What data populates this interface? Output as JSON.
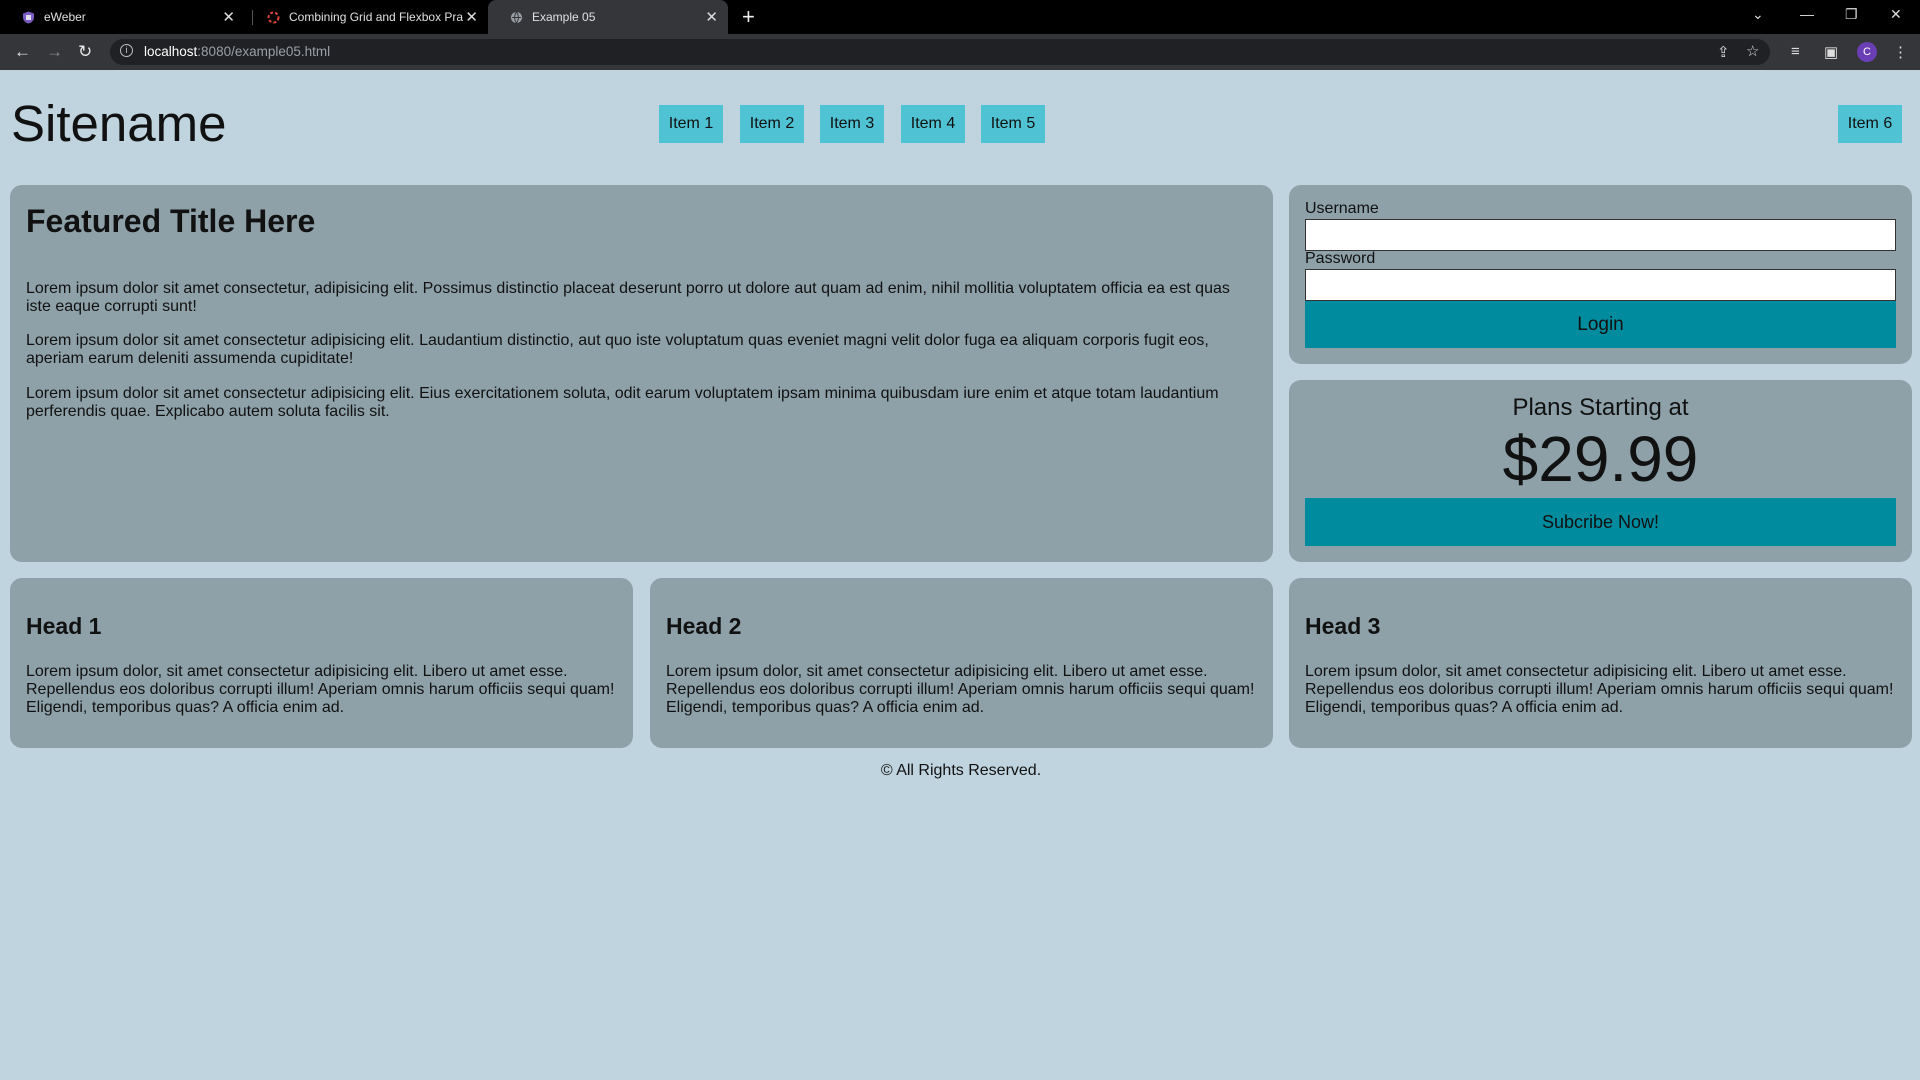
{
  "browser": {
    "tabs": [
      {
        "title": "eWeber",
        "active": false
      },
      {
        "title": "Combining Grid and Flexbox Pra",
        "active": false
      },
      {
        "title": "Example 05",
        "active": true
      }
    ],
    "url_host": "localhost",
    "url_rest": ":8080/example05.html",
    "profile_initial": "C"
  },
  "header": {
    "sitename": "Sitename",
    "nav": [
      "Item 1",
      "Item 2",
      "Item 3",
      "Item 4",
      "Item 5",
      "Item 6"
    ]
  },
  "featured": {
    "title": "Featured Title Here",
    "paragraphs": [
      "Lorem ipsum dolor sit amet consectetur, adipisicing elit. Possimus distinctio placeat deserunt porro ut dolore aut quam ad enim, nihil mollitia voluptatem officia ea est quas iste eaque corrupti sunt!",
      "Lorem ipsum dolor sit amet consectetur adipisicing elit. Laudantium distinctio, aut quo iste voluptatum quas eveniet magni velit dolor fuga ea aliquam corporis fugit eos, aperiam earum deleniti assumenda cupiditate!",
      "Lorem ipsum dolor sit amet consectetur adipisicing elit. Eius exercitationem soluta, odit earum voluptatem ipsam minima quibusdam iure enim et atque totam laudantium perferendis quae. Explicabo autem soluta facilis sit."
    ]
  },
  "login": {
    "username_label": "Username",
    "username_value": "",
    "password_label": "Password",
    "password_value": "",
    "button": "Login"
  },
  "plans": {
    "title": "Plans Starting at",
    "price": "$29.99",
    "button": "Subcribe Now!"
  },
  "cards": [
    {
      "head": "Head 1",
      "body": "Lorem ipsum dolor, sit amet consectetur adipisicing elit. Libero ut amet esse. Repellendus eos doloribus corrupti illum! Aperiam omnis harum officiis sequi quam! Eligendi, temporibus quas? A officia enim ad."
    },
    {
      "head": "Head 2",
      "body": "Lorem ipsum dolor, sit amet consectetur adipisicing elit. Libero ut amet esse. Repellendus eos doloribus corrupti illum! Aperiam omnis harum officiis sequi quam! Eligendi, temporibus quas? A officia enim ad."
    },
    {
      "head": "Head 3",
      "body": "Lorem ipsum dolor, sit amet consectetur adipisicing elit. Libero ut amet esse. Repellendus eos doloribus corrupti illum! Aperiam omnis harum officiis sequi quam! Eligendi, temporibus quas? A officia enim ad."
    }
  ],
  "footer": {
    "text": "© All Rights Reserved."
  },
  "colors": {
    "page_bg": "#c0d4df",
    "card_bg": "#8ea1a9",
    "nav_item_bg": "#4fc3d4",
    "button_bg": "#008c9e"
  }
}
